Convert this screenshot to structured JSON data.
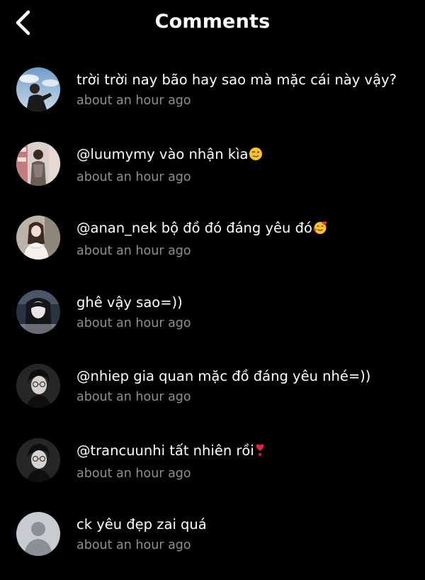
{
  "header": {
    "title": "Comments",
    "back_icon": "chevron-left-icon"
  },
  "colors": {
    "background": "#000000",
    "text": "#ffffff",
    "timestamp": "#8e8e93"
  },
  "comments": [
    {
      "text": "trời trời nay bão hay sao mà mặc cái này vậy?",
      "time": "about an hour ago",
      "avatar": "user-photo-man-sky"
    },
    {
      "text": "@luumymy vào nhận kìa",
      "emoji": "winking-face",
      "time": "about an hour ago",
      "avatar": "user-photo-girl-shop"
    },
    {
      "text": "@anan_nek bộ đồ đó đáng yêu đó",
      "emoji": "smiling-face-with-hearts",
      "time": "about an hour ago",
      "avatar": "user-photo-girl-dress"
    },
    {
      "text": "ghê vậy sao=))",
      "time": "about an hour ago",
      "avatar": "user-photo-girl-dark"
    },
    {
      "text": "@nhiep gia quan mặc đồ đáng yêu nhé=))",
      "time": "about an hour ago",
      "avatar": "user-photo-boy-glasses"
    },
    {
      "text": "@trancuunhi tất nhiên rồi",
      "emoji": "red-heart-exclamation",
      "time": "about an hour ago",
      "avatar": "user-photo-boy-glasses"
    },
    {
      "text": "ck yêu đẹp zai quá",
      "time": "about an hour ago",
      "avatar": "default-avatar"
    }
  ]
}
